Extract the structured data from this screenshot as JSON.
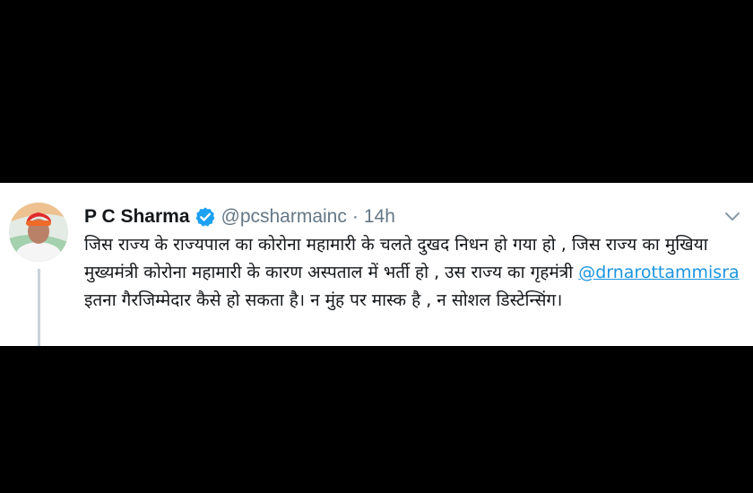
{
  "tweet": {
    "author": {
      "display_name": "P C Sharma",
      "handle": "@pcsharmainc",
      "verified": true,
      "avatar_icon": "profile-photo"
    },
    "separator": "·",
    "timestamp": "14h",
    "menu_icon": "chevron-down-icon",
    "text": {
      "part1": "जिस राज्य के राज्यपाल का कोरोना महामारी के चलते दुखद निधन हो गया हो , जिस राज्य का मुखिया मुख्यमंत्री कोरोना महामारी के कारण अस्पताल में भर्ती हो , उस राज्य का गृहमंत्री ",
      "mention": "@drnarottammisra",
      "part2": " इतना गैरजिम्मेदार कैसे हो सकता है। न मुंह पर मास्क है , न सोशल डिस्टेन्सिंग।"
    },
    "colors": {
      "link": "#1b95e0",
      "verified_badge": "#1da1f2",
      "secondary_text": "#657786"
    }
  }
}
